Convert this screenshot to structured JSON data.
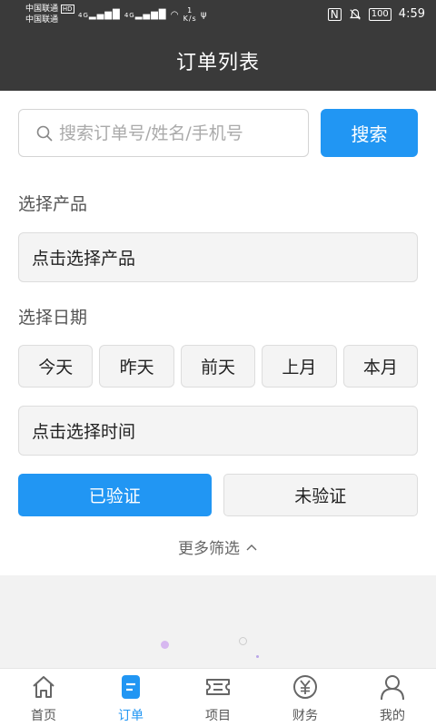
{
  "status_bar": {
    "carrier_1": "中国联通",
    "carrier_2": "中国联通",
    "hd": "HD",
    "net_1": "4G",
    "net_2": "4G",
    "speed_value": "1",
    "speed_unit": "K/s",
    "battery": "100",
    "time": "4:59"
  },
  "header": {
    "title": "订单列表"
  },
  "search": {
    "placeholder": "搜索订单号/姓名/手机号",
    "button_label": "搜索"
  },
  "product": {
    "section_label": "选择产品",
    "field_label": "点击选择产品"
  },
  "date": {
    "section_label": "选择日期",
    "options": [
      "今天",
      "昨天",
      "前天",
      "上月",
      "本月"
    ],
    "time_field_label": "点击选择时间"
  },
  "verify": {
    "verified_label": "已验证",
    "unverified_label": "未验证",
    "selected": "已验证"
  },
  "more_filter_label": "更多筛选",
  "tabbar": {
    "items": [
      {
        "label": "首页",
        "icon": "home-icon",
        "active": false
      },
      {
        "label": "订单",
        "icon": "order-icon",
        "active": true
      },
      {
        "label": "项目",
        "icon": "ticket-icon",
        "active": false
      },
      {
        "label": "财务",
        "icon": "yuan-icon",
        "active": false
      },
      {
        "label": "我的",
        "icon": "user-icon",
        "active": false
      }
    ]
  },
  "colors": {
    "accent": "#2196f3",
    "header_bg": "#3a3a3a",
    "page_bg": "#f2f2f2"
  }
}
